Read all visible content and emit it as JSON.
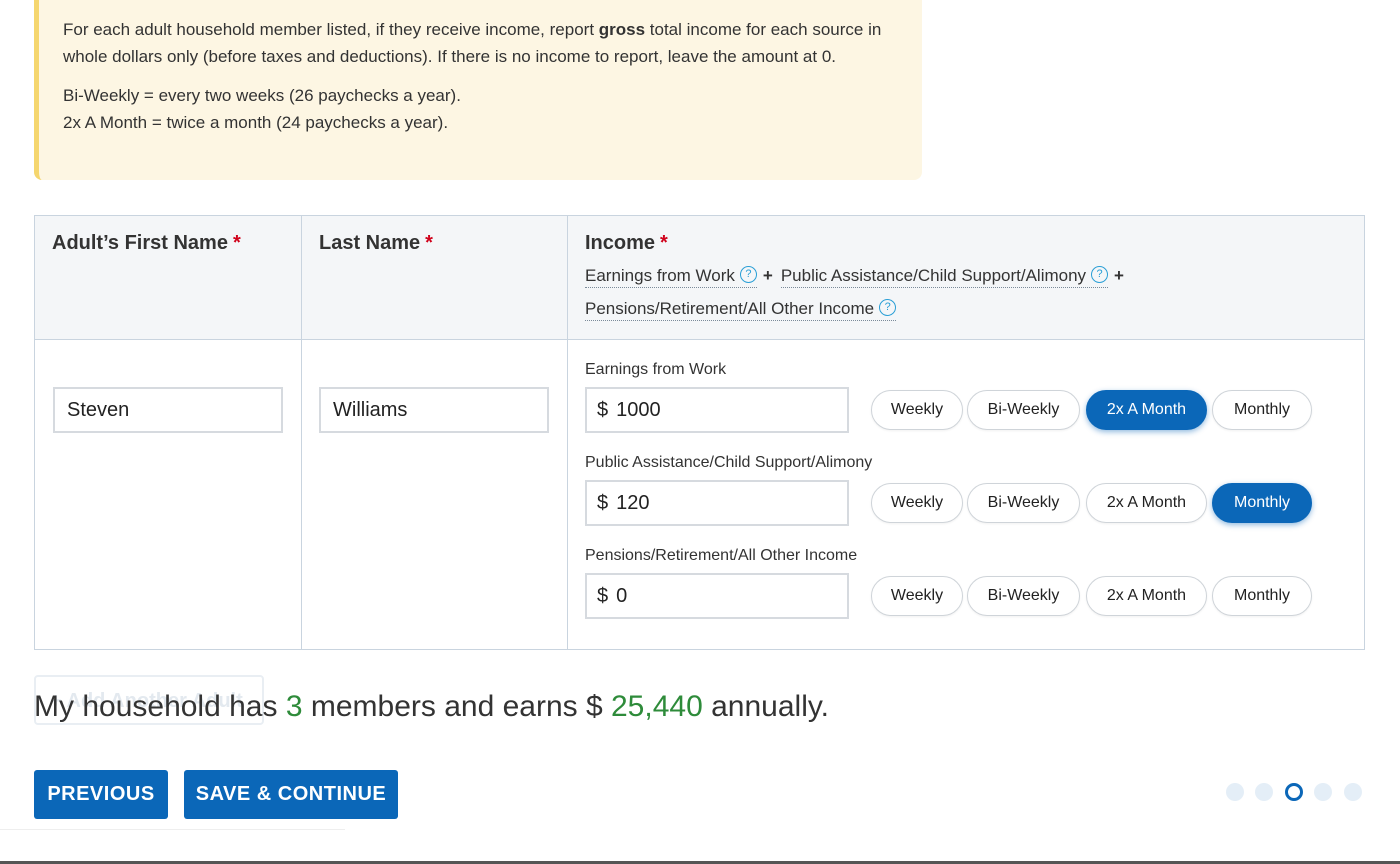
{
  "notice": {
    "line1_pre": "For each adult household member listed, if they receive income, report ",
    "line1_bold": "gross",
    "line1_post": " total income for each source in whole dollars only (before taxes and deductions). If there is no income to report, leave the amount at 0.",
    "line2": "Bi-Weekly = every two weeks (26 paychecks a year).",
    "line3": "2x A Month = twice a month (24 paychecks a year)."
  },
  "table": {
    "headers": {
      "first_name": "Adult’s First Name",
      "last_name": "Last Name",
      "income": "Income",
      "required_mark": "*"
    },
    "income_help": {
      "earnings": "Earnings from Work",
      "assistance": "Public Assistance/Child Support/Alimony",
      "pensions": "Pensions/Retirement/All Other Income",
      "plus": "+",
      "help_icon": "?"
    },
    "row": {
      "first_name": "Steven",
      "last_name": "Williams",
      "currency_symbol": "$",
      "income_sources": [
        {
          "label": "Earnings from Work",
          "amount": "1000",
          "selected_frequency": "2x A Month"
        },
        {
          "label": "Public Assistance/Child Support/Alimony",
          "amount": "120",
          "selected_frequency": "Monthly"
        },
        {
          "label": "Pensions/Retirement/All Other Income",
          "amount": "0",
          "selected_frequency": ""
        }
      ],
      "frequencies": [
        "Weekly",
        "Bi-Weekly",
        "2x A Month",
        "Monthly"
      ]
    }
  },
  "add_adult_label": "+ Add Another Adult",
  "summary": {
    "pre": "My household has ",
    "members": "3",
    "mid": " members and earns $ ",
    "amount": "25,440",
    "post": " annually."
  },
  "buttons": {
    "previous": "PREVIOUS",
    "save_continue": "SAVE & CONTINUE"
  },
  "progress": {
    "total_steps": 5,
    "current_step": 3
  },
  "colors": {
    "accent": "#0b67b8",
    "notice_bg": "#fdf6e3",
    "notice_border": "#f5d66e",
    "highlight_green": "#2e8b3a",
    "required_red": "#d0021b"
  }
}
